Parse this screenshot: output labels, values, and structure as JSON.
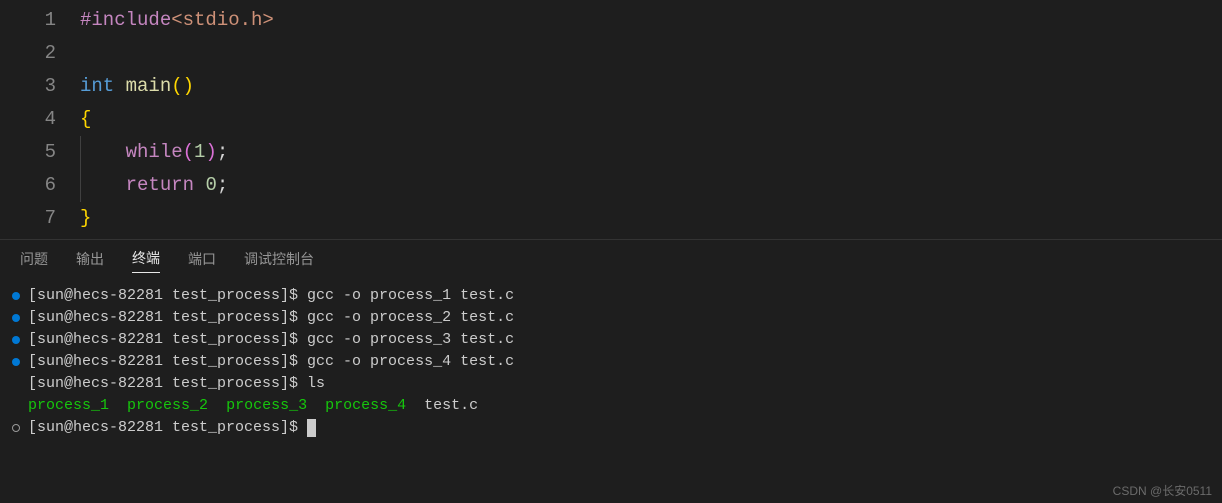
{
  "editor": {
    "lines": [
      {
        "num": "1",
        "tokens": [
          {
            "cls": "tok-directive",
            "t": "#include"
          },
          {
            "cls": "tok-string",
            "t": "<stdio.h>"
          }
        ]
      },
      {
        "num": "2",
        "tokens": []
      },
      {
        "num": "3",
        "tokens": [
          {
            "cls": "tok-keyword",
            "t": "int"
          },
          {
            "cls": "tok-default",
            "t": " "
          },
          {
            "cls": "tok-function",
            "t": "main"
          },
          {
            "cls": "tok-bracket-yellow",
            "t": "()"
          }
        ]
      },
      {
        "num": "4",
        "tokens": [
          {
            "cls": "tok-bracket-yellow",
            "t": "{"
          }
        ]
      },
      {
        "num": "5",
        "guide": true,
        "tokens": [
          {
            "cls": "tok-default",
            "t": "    "
          },
          {
            "cls": "tok-control",
            "t": "while"
          },
          {
            "cls": "tok-bracket-purple",
            "t": "("
          },
          {
            "cls": "tok-number",
            "t": "1"
          },
          {
            "cls": "tok-bracket-purple",
            "t": ")"
          },
          {
            "cls": "tok-default",
            "t": ";"
          }
        ]
      },
      {
        "num": "6",
        "guide": true,
        "tokens": [
          {
            "cls": "tok-default",
            "t": "    "
          },
          {
            "cls": "tok-control",
            "t": "return"
          },
          {
            "cls": "tok-default",
            "t": " "
          },
          {
            "cls": "tok-number",
            "t": "0"
          },
          {
            "cls": "tok-default",
            "t": ";"
          }
        ]
      },
      {
        "num": "7",
        "tokens": [
          {
            "cls": "tok-bracket-yellow",
            "t": "}"
          }
        ]
      }
    ]
  },
  "panel": {
    "tabs": {
      "problems": "问题",
      "output": "输出",
      "terminal": "终端",
      "ports": "端口",
      "debugConsole": "调试控制台"
    },
    "activeTab": "terminal"
  },
  "terminal": {
    "lines": [
      {
        "marker": "dot",
        "text": "[sun@hecs-82281 test_process]$ gcc -o process_1 test.c"
      },
      {
        "marker": "dot",
        "text": "[sun@hecs-82281 test_process]$ gcc -o process_2 test.c"
      },
      {
        "marker": "dot",
        "text": "[sun@hecs-82281 test_process]$ gcc -o process_3 test.c"
      },
      {
        "marker": "dot",
        "text": "[sun@hecs-82281 test_process]$ gcc -o process_4 test.c"
      },
      {
        "marker": "none",
        "text": "[sun@hecs-82281 test_process]$ ls"
      }
    ],
    "lsOutput": {
      "items": [
        "process_1",
        "process_2",
        "process_3",
        "process_4"
      ],
      "file": "test.c"
    },
    "promptLine": {
      "marker": "circle",
      "text": "[sun@hecs-82281 test_process]$ "
    }
  },
  "watermark": "CSDN @长安0511"
}
